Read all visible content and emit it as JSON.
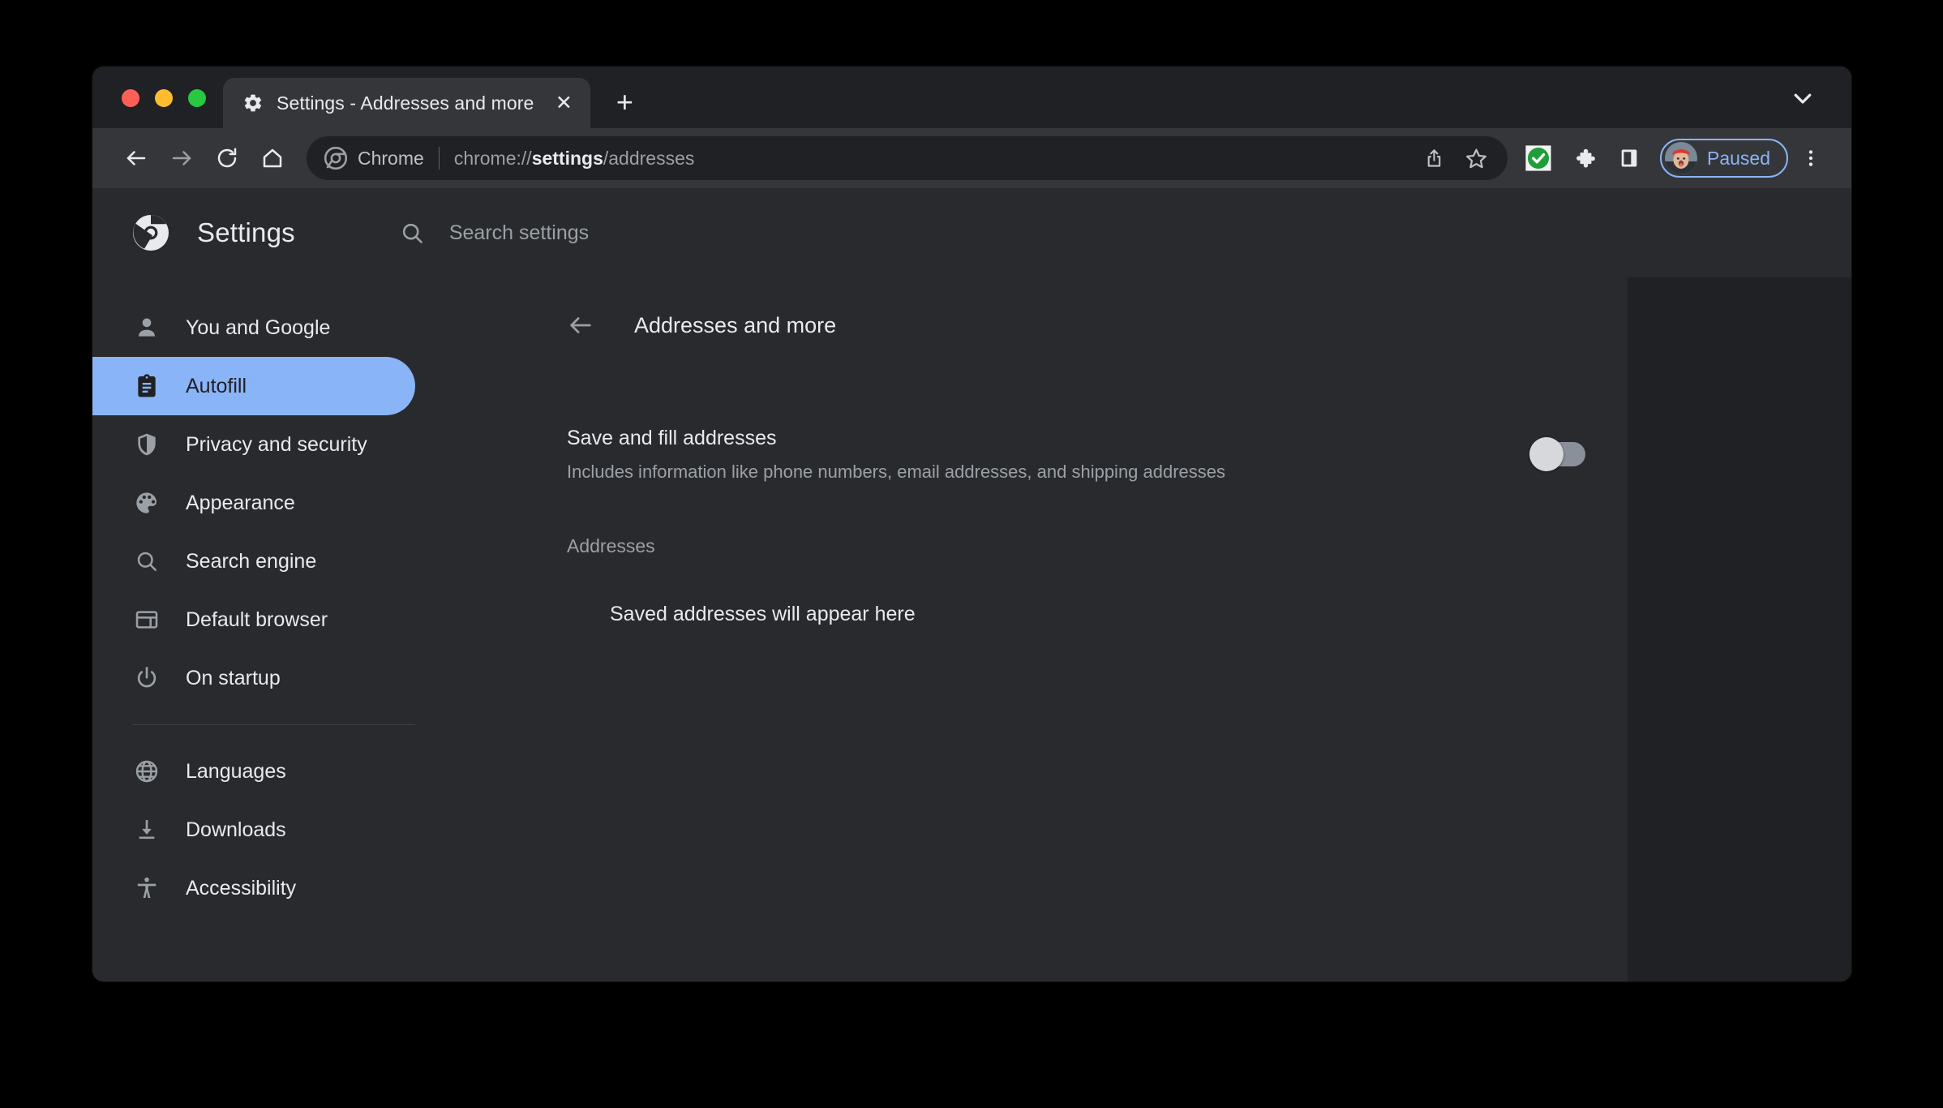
{
  "window": {
    "traffic_lights": [
      "close",
      "minimize",
      "maximize"
    ],
    "colors": {
      "accent": "#8ab4f8",
      "surface": "#292a2d",
      "background": "#202124",
      "text": "#e8eaed",
      "muted": "#9aa0a6"
    }
  },
  "tabstrip": {
    "tab_title": "Settings - Addresses and more",
    "tab_favicon": "gear-icon",
    "close_label": "✕",
    "new_tab_label": "+",
    "tab_search_icon": "chevron-down-icon"
  },
  "toolbar": {
    "back_icon": "back-arrow-icon",
    "forward_icon": "forward-arrow-icon",
    "reload_icon": "reload-icon",
    "home_icon": "home-icon",
    "chip_label": "Chrome",
    "url_prefix": "chrome://",
    "url_bold": "settings",
    "url_suffix": "/addresses",
    "share_icon": "share-icon",
    "bookmark_icon": "star-icon",
    "extension_check_icon": "green-check-extension-icon",
    "extensions_icon": "puzzle-piece-icon",
    "side_panel_icon": "side-panel-icon",
    "profile_status": "Paused",
    "menu_icon": "three-dot-menu-icon"
  },
  "settings": {
    "logo": "chrome-logo-icon",
    "title": "Settings",
    "search": {
      "icon": "search-icon",
      "placeholder": "Search settings",
      "value": ""
    }
  },
  "sidebar": {
    "items": [
      {
        "label": "You and Google",
        "icon": "person-icon",
        "active": false
      },
      {
        "label": "Autofill",
        "icon": "clipboard-icon",
        "active": true
      },
      {
        "label": "Privacy and security",
        "icon": "shield-icon",
        "active": false
      },
      {
        "label": "Appearance",
        "icon": "palette-icon",
        "active": false
      },
      {
        "label": "Search engine",
        "icon": "magnifier-icon",
        "active": false
      },
      {
        "label": "Default browser",
        "icon": "browser-window-icon",
        "active": false
      },
      {
        "label": "On startup",
        "icon": "power-icon",
        "active": false
      }
    ],
    "items2": [
      {
        "label": "Languages",
        "icon": "globe-icon",
        "active": false
      },
      {
        "label": "Downloads",
        "icon": "download-icon",
        "active": false
      },
      {
        "label": "Accessibility",
        "icon": "accessibility-icon",
        "active": false
      }
    ]
  },
  "main": {
    "back_icon": "back-arrow-icon",
    "page_title": "Addresses and more",
    "save_fill": {
      "title": "Save and fill addresses",
      "description": "Includes information like phone numbers, email addresses, and shipping addresses",
      "toggle_state": "off"
    },
    "addresses_section_title": "Addresses",
    "empty_state": "Saved addresses will appear here"
  }
}
